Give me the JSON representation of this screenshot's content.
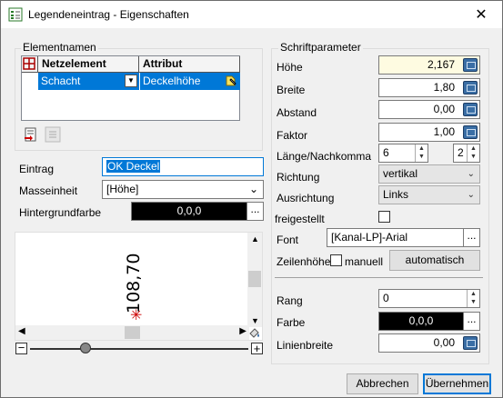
{
  "window": {
    "title": "Legendeneintrag - Eigenschaften",
    "close_glyph": "✕"
  },
  "left": {
    "group_title": "Elementnamen",
    "grid": {
      "columns": [
        "Netzelement",
        "Attribut"
      ],
      "rows": [
        {
          "netzelement": "Schacht",
          "attribut": "Deckelhöhe"
        }
      ]
    },
    "fields": {
      "eintrag_label": "Eintrag",
      "eintrag_value": "OK Deckel",
      "masseinheit_label": "Masseinheit",
      "masseinheit_value": "[Höhe]",
      "hintergrund_label": "Hintergrundfarbe",
      "hintergrund_value": "0,0,0",
      "dots": "..."
    },
    "preview": {
      "text": "108,70",
      "marker": "✳"
    }
  },
  "right": {
    "group_title": "Schriftparameter",
    "hoehe_label": "Höhe",
    "hoehe_value": "2,167",
    "breite_label": "Breite",
    "breite_value": "1,80",
    "abstand_label": "Abstand",
    "abstand_value": "0,00",
    "faktor_label": "Faktor",
    "faktor_value": "1,00",
    "laenge_label": "Länge/Nachkomma",
    "laenge_value": "6",
    "nachkomma_value": "2",
    "richtung_label": "Richtung",
    "richtung_value": "vertikal",
    "ausrichtung_label": "Ausrichtung",
    "ausrichtung_value": "Links",
    "freigestellt_label": "freigestellt",
    "font_label": "Font",
    "font_value": "[Kanal-LP]-Arial",
    "zeilenhoehe_label": "Zeilenhöhe",
    "manuell_label": "manuell",
    "automatisch_label": "automatisch",
    "rang_label": "Rang",
    "rang_value": "0",
    "farbe_label": "Farbe",
    "farbe_value": "0,0,0",
    "linienbreite_label": "Linienbreite",
    "linienbreite_value": "0,00",
    "dots": "..."
  },
  "footer": {
    "cancel_label": "Abbrechen",
    "ok_label": "Übernehmen"
  },
  "colors": {
    "accent": "#0078d7",
    "selection": "#0078d7",
    "marker": "#cc0000",
    "input_highlight": "#fefbe1"
  },
  "icons": [
    "legend-window-icon",
    "close-icon",
    "grid-corner-icon",
    "tooltip-pencil-icon",
    "insert-row-icon",
    "delete-row-icon",
    "calculator-icon",
    "zoom-minus-icon",
    "zoom-plus-icon",
    "fill-icon"
  ]
}
